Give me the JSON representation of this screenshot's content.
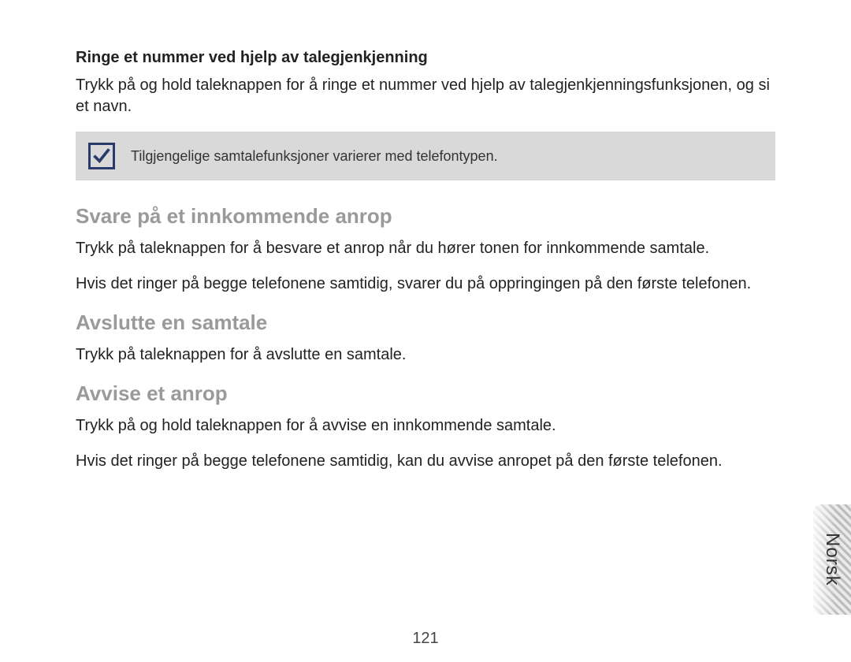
{
  "sections": {
    "voice_dial": {
      "heading": "Ringe et nummer ved hjelp av talegjenkjenning",
      "body": "Trykk på og hold taleknappen for å ringe et nummer ved hjelp av talegjenkjennings­funksjonen, og si et navn."
    },
    "note": "Tilgjengelige samtalefunksjoner varierer med telefontypen.",
    "answer": {
      "heading": "Svare på et innkommende anrop",
      "p1": "Trykk på taleknappen for å besvare et anrop når du hører tonen for innkommende samtale.",
      "p2": "Hvis det ringer på begge telefonene samtidig, svarer du på oppringingen på den første telefonen."
    },
    "end": {
      "heading": "Avslutte en samtale",
      "p1": "Trykk på taleknappen for å avslutte en samtale."
    },
    "reject": {
      "heading": "Avvise et anrop",
      "p1": "Trykk på og hold taleknappen for å avvise en innkommende samtale.",
      "p2": "Hvis det ringer på begge telefonene samtidig, kan du avvise anropet på den første telefonen."
    }
  },
  "page_number": "121",
  "language_tab": "Norsk"
}
